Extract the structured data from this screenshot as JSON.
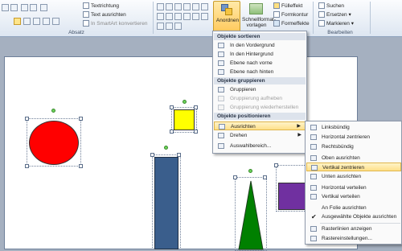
{
  "ribbon": {
    "text_direction": "Textrichtung",
    "align_text": "Text ausrichten",
    "smartart": "In SmartArt konvertieren",
    "paragraph_label": "Absatz",
    "arrange_label": "Anordnen",
    "quick_styles_label": "Schnellformat-vorlagen",
    "fill": "Fülleffekt",
    "outline": "Formkontur",
    "effects": "Formeffekte",
    "find": "Suchen",
    "replace": "Ersetzen",
    "select": "Markieren",
    "editing_label": "Bearbeiten"
  },
  "arrange_menu": {
    "section_sort": "Objekte sortieren",
    "bring_front": "In den Vordergrund",
    "send_back": "In den Hintergrund",
    "bring_forward": "Ebene nach vorne",
    "send_backward": "Ebene nach hinten",
    "section_group": "Objekte gruppieren",
    "group": "Gruppieren",
    "ungroup": "Gruppierung aufheben",
    "regroup": "Gruppierung wiederherstellen",
    "section_position": "Objekte positionieren",
    "align": "Ausrichten",
    "rotate": "Drehen",
    "selection_pane": "Auswahlbereich..."
  },
  "align_menu": {
    "left": "Linksbündig",
    "center_h": "Horizontal zentrieren",
    "right": "Rechtsbündig",
    "top": "Oben ausrichten",
    "middle_v": "Vertikal zentrieren",
    "bottom": "Unten ausrichten",
    "distribute_h": "Horizontal verteilen",
    "distribute_v": "Vertikal verteilen",
    "to_slide": "An Folie ausrichten",
    "selected_objects": "Ausgewählte Objekte ausrichten",
    "show_gridlines": "Rasterlinien anzeigen",
    "grid_settings": "Rastereinstellungen..."
  },
  "colors": {
    "circle": "#ff0000",
    "square": "#ffff00",
    "rect": "#3a5e8c",
    "triangle": "#008000",
    "purple": "#7030a0",
    "highlight": "#ffe08a"
  }
}
